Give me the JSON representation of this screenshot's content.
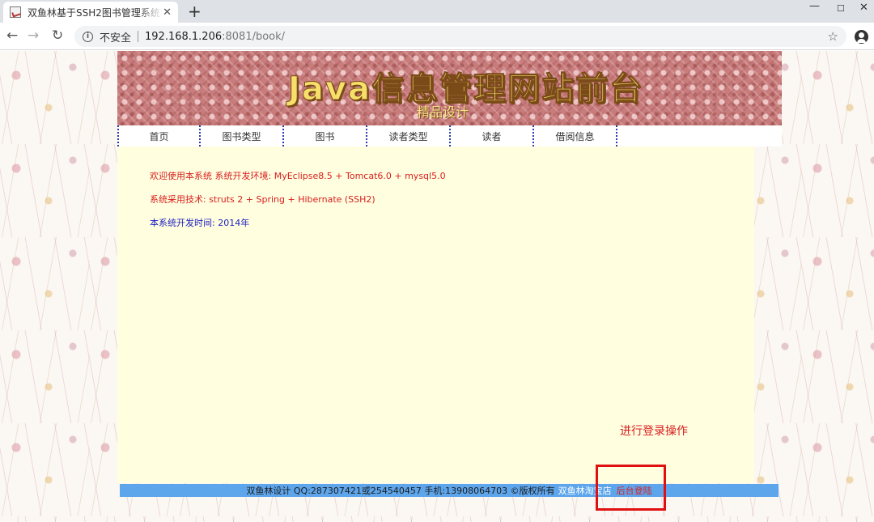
{
  "browser": {
    "tab_title": "双鱼林基于SSH2图书管理系统",
    "tab_close": "✕",
    "new_tab": "+",
    "window_min": "—",
    "window_max": "☐",
    "window_close": "✕",
    "nav_back": "←",
    "nav_forward": "→",
    "nav_reload": "↻",
    "security_info": "i",
    "security_label": "不安全",
    "url_host": "192.168.1.206",
    "url_path": ":8081/book/",
    "bookmark_star": "☆"
  },
  "banner": {
    "title": "Java信息管理网站前台",
    "subtitle": "精品设计"
  },
  "nav": {
    "items": [
      {
        "label": "首页"
      },
      {
        "label": "图书类型"
      },
      {
        "label": "图书"
      },
      {
        "label": "读者类型"
      },
      {
        "label": "读者"
      },
      {
        "label": "借阅信息"
      }
    ]
  },
  "content": {
    "line1": "欢迎使用本系统 系统开发环境: MyEclipse8.5 + Tomcat6.0 + mysql5.0",
    "line2": "系统采用技术: struts 2 + Spring + Hibernate (SSH2)",
    "line3": "本系统开发时间: 2014年",
    "login_hint": "进行登录操作"
  },
  "footer": {
    "text": "双鱼林设计 QQ:287307421或254540457 手机:13908064703 ©版权所有",
    "shop_link": "双鱼林淘宝店",
    "admin_login": "后台登陆"
  },
  "colors": {
    "content_bg": "#ffffe0",
    "footer_bg": "#5ea6ec",
    "red_text": "#d81e1e",
    "blue_text": "#2020c0",
    "highlight": "#e01010"
  }
}
